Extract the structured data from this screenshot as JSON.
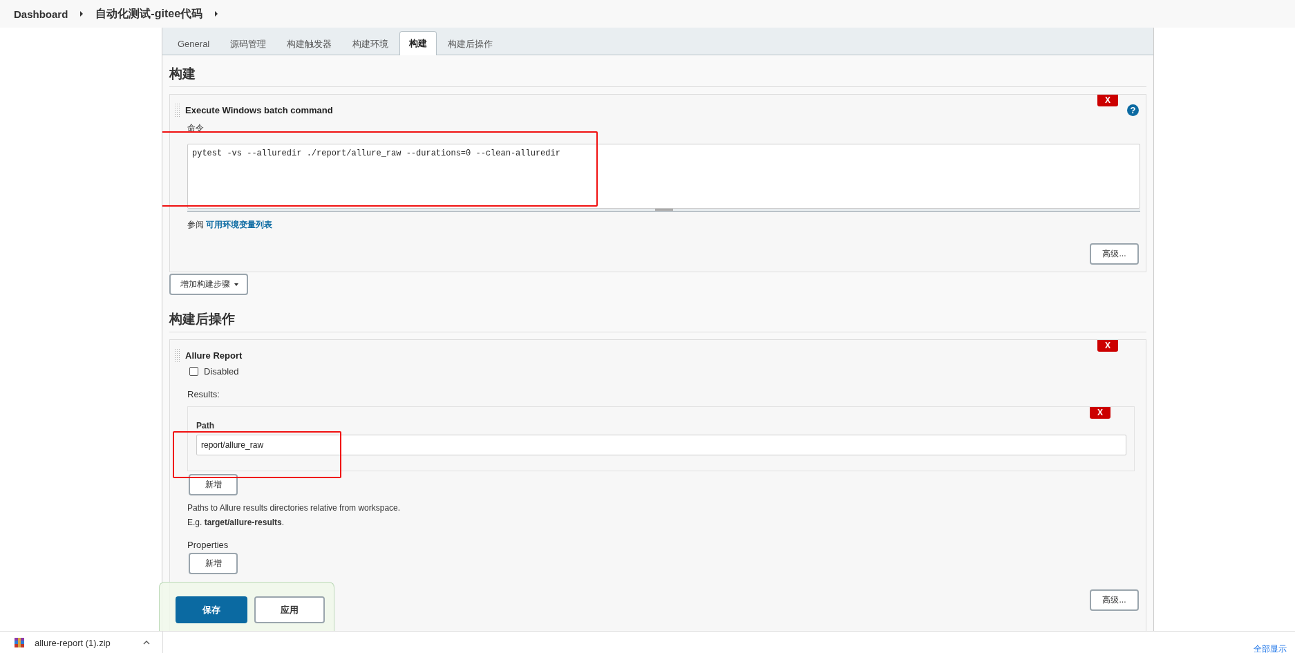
{
  "breadcrumb": [
    {
      "label": "Dashboard"
    },
    {
      "label": "自动化测试-gitee代码"
    }
  ],
  "tabs": [
    {
      "label": "General",
      "selected": false
    },
    {
      "label": "源码管理",
      "selected": false
    },
    {
      "label": "构建触发器",
      "selected": false
    },
    {
      "label": "构建环境",
      "selected": false
    },
    {
      "label": "构建",
      "selected": true
    },
    {
      "label": "构建后操作",
      "selected": false
    }
  ],
  "build": {
    "heading": "构建",
    "step": {
      "title": "Execute Windows batch command",
      "delete_button": "X",
      "help_icon": "?",
      "command_label": "命令",
      "command": "pytest -vs --alluredir ./report/allure_raw --durations=0 --clean-alluredir",
      "see_also": "参阅",
      "env_link": "可用环境变量列表",
      "advanced_button": "高级..."
    },
    "add_step_button": "增加构建步骤"
  },
  "post_build": {
    "heading": "构建后操作",
    "step": {
      "title": "Allure Report",
      "delete_button": "X",
      "disabled": {
        "label": "Disabled",
        "checked": false
      },
      "results_label": "Results:",
      "path": {
        "delete_button": "X",
        "label": "Path",
        "value": "report/allure_raw"
      },
      "add_button": "新增",
      "help": "Paths to Allure results directories relative from workspace.",
      "example": "E.g. **target/allure-results**.",
      "properties_label": "Properties",
      "properties_add_button": "新增",
      "advanced_button": "高级..."
    }
  },
  "footer": {
    "save_button": "保存",
    "apply_button": "应用"
  },
  "download_bar": {
    "file": "allure-report (1).zip",
    "show_all": "全部显示"
  }
}
